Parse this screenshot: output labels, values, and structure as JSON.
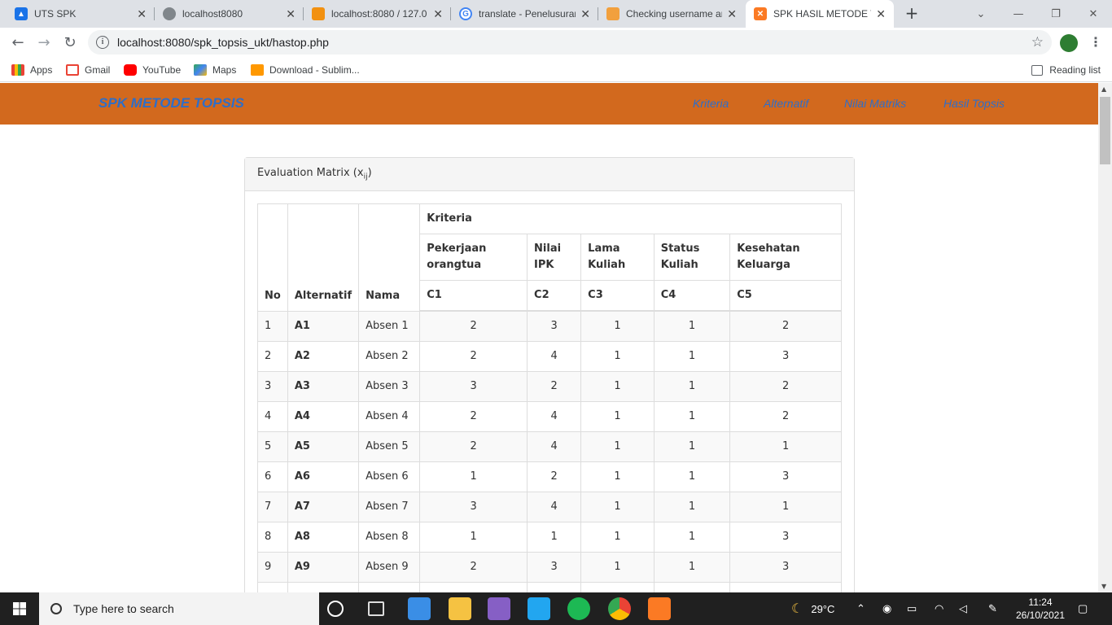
{
  "browser": {
    "tabs": [
      {
        "title": "UTS SPK"
      },
      {
        "title": "localhost8080"
      },
      {
        "title": "localhost:8080 / 127.0"
      },
      {
        "title": "translate - Penelusuran"
      },
      {
        "title": "Checking username an"
      },
      {
        "title": "SPK HASIL METODE TO"
      }
    ],
    "url": "localhost:8080/spk_topsis_ukt/hastop.php",
    "bookmarks": [
      "Apps",
      "Gmail",
      "YouTube",
      "Maps",
      "Download - Sublim..."
    ],
    "reading_list": "Reading list"
  },
  "navbar": {
    "brand": "SPK METODE TOPSIS",
    "links": [
      "Kriteria",
      "Alternatif",
      "Nilai Matriks",
      "Hasil Topsis"
    ]
  },
  "panel": {
    "heading": "Evaluation Matrix (x",
    "heading_sub": "ij",
    "heading_end": ")"
  },
  "table": {
    "head_no": "No",
    "head_alt": "Alternatif",
    "head_nama": "Nama",
    "head_kriteria": "Kriteria",
    "criteria": [
      {
        "name": "Pekerjaan orangtua",
        "code": "C1"
      },
      {
        "name": "Nilai IPK",
        "code": "C2"
      },
      {
        "name": "Lama Kuliah",
        "code": "C3"
      },
      {
        "name": "Status Kuliah",
        "code": "C4"
      },
      {
        "name": "Kesehatan Keluarga",
        "code": "C5"
      }
    ],
    "rows": [
      {
        "no": "1",
        "alt": "A1",
        "nama": "Absen 1",
        "v": [
          "2",
          "3",
          "1",
          "1",
          "2"
        ]
      },
      {
        "no": "2",
        "alt": "A2",
        "nama": "Absen 2",
        "v": [
          "2",
          "4",
          "1",
          "1",
          "3"
        ]
      },
      {
        "no": "3",
        "alt": "A3",
        "nama": "Absen 3",
        "v": [
          "3",
          "2",
          "1",
          "1",
          "2"
        ]
      },
      {
        "no": "4",
        "alt": "A4",
        "nama": "Absen 4",
        "v": [
          "2",
          "4",
          "1",
          "1",
          "2"
        ]
      },
      {
        "no": "5",
        "alt": "A5",
        "nama": "Absen 5",
        "v": [
          "2",
          "4",
          "1",
          "1",
          "1"
        ]
      },
      {
        "no": "6",
        "alt": "A6",
        "nama": "Absen 6",
        "v": [
          "1",
          "2",
          "1",
          "1",
          "3"
        ]
      },
      {
        "no": "7",
        "alt": "A7",
        "nama": "Absen 7",
        "v": [
          "3",
          "4",
          "1",
          "1",
          "1"
        ]
      },
      {
        "no": "8",
        "alt": "A8",
        "nama": "Absen 8",
        "v": [
          "1",
          "1",
          "1",
          "1",
          "3"
        ]
      },
      {
        "no": "9",
        "alt": "A9",
        "nama": "Absen 9",
        "v": [
          "2",
          "3",
          "1",
          "1",
          "3"
        ]
      }
    ]
  },
  "taskbar": {
    "search_placeholder": "Type here to search",
    "weather": "29°C",
    "time": "11:24",
    "date": "26/10/2021"
  },
  "colors": {
    "navbar_bg": "#d2691e",
    "nav_text": "#2f6ec8"
  }
}
